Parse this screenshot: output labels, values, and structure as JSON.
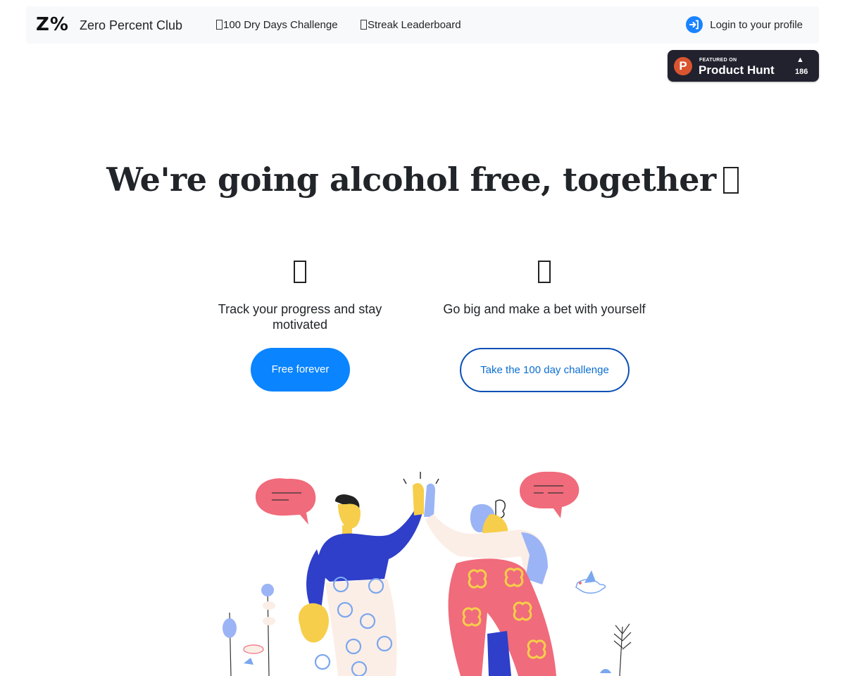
{
  "navbar": {
    "logo": "Z%",
    "brand": "Zero Percent Club",
    "links": [
      {
        "label": "100 Dry Days Challenge"
      },
      {
        "label": "Streak Leaderboard"
      }
    ],
    "login": {
      "label": "Login to your profile",
      "icon": "login-icon"
    }
  },
  "product_hunt": {
    "featured": "FEATURED ON",
    "name": "Product Hunt",
    "logo_letter": "P",
    "arrow": "▲",
    "count": "186"
  },
  "hero": {
    "headline": "We're going alcohol free, together"
  },
  "features": [
    {
      "caption": "Track your progress and stay motivated",
      "button": "Free forever"
    },
    {
      "caption": "Go big and make a bet with yourself",
      "button": "Take the 100 day challenge"
    }
  ],
  "colors": {
    "primary": "#0a84ff",
    "outline": "#0a4fb5",
    "navbar_bg": "#f8f9fa",
    "badge_bg": "#21222e",
    "ph_orange": "#da552f",
    "speech_pink": "#f06b7b",
    "shirt_blue": "#2f3fc9",
    "skin_yellow": "#f6ce4b",
    "pale_blue": "#9bb4f6"
  }
}
